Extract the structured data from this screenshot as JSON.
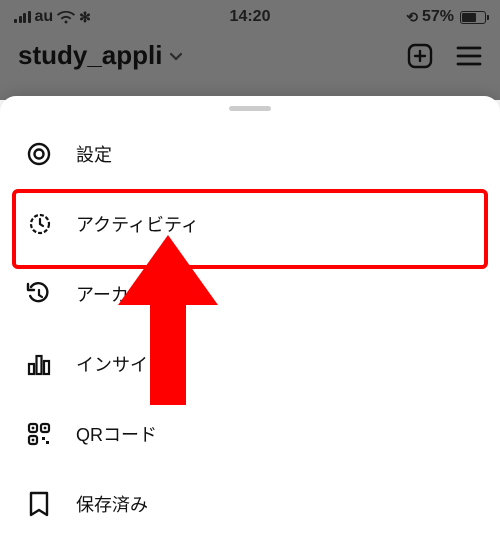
{
  "status": {
    "carrier": "au",
    "time": "14:20",
    "battery": "57%"
  },
  "header": {
    "username": "study_appli"
  },
  "menu": {
    "items": [
      {
        "label": "設定"
      },
      {
        "label": "アクティビティ"
      },
      {
        "label": "アーカイブ"
      },
      {
        "label": "インサイト"
      },
      {
        "label": "QRコード"
      },
      {
        "label": "保存済み"
      }
    ]
  },
  "highlight": {
    "target_index": 1
  }
}
